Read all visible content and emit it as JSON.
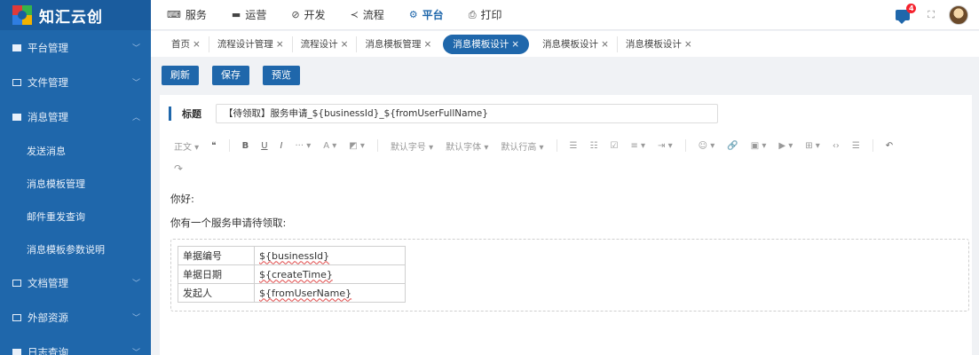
{
  "app": {
    "logo_text": "知汇云创"
  },
  "sidebar": {
    "items": [
      {
        "label": "平台管理",
        "chevron": "﹀"
      },
      {
        "label": "文件管理",
        "chevron": "﹀"
      },
      {
        "label": "消息管理",
        "chevron": "︿",
        "children": [
          "发送消息",
          "消息模板管理",
          "邮件重发查询",
          "消息模板参数说明"
        ]
      },
      {
        "label": "文档管理",
        "chevron": "﹀"
      },
      {
        "label": "外部资源",
        "chevron": "﹀"
      },
      {
        "label": "日志查询",
        "chevron": "﹀"
      }
    ]
  },
  "topnav": {
    "items": [
      {
        "label": "服务",
        "icon": "⌨"
      },
      {
        "label": "运营",
        "icon": "▬"
      },
      {
        "label": "开发",
        "icon": "⊘"
      },
      {
        "label": "流程",
        "icon": "≺"
      },
      {
        "label": "平台",
        "icon": "⚙"
      },
      {
        "label": "打印",
        "icon": "⎙"
      }
    ],
    "badge_count": "4",
    "fullscreen_glyph": "⛶"
  },
  "tabs": [
    {
      "label": "首页"
    },
    {
      "label": "流程设计管理"
    },
    {
      "label": "流程设计"
    },
    {
      "label": "消息模板管理"
    },
    {
      "label": "消息模板设计"
    },
    {
      "label": "消息模板设计"
    },
    {
      "label": "消息模板设计"
    }
  ],
  "tab_close": "×",
  "toolbar": {
    "refresh": "刷新",
    "save": "保存",
    "preview": "预览"
  },
  "form": {
    "title_label": "标题",
    "title_value": "【待领取】服务申请_${businessId}_${fromUserFullName}"
  },
  "editor_toolbar": {
    "paragraph": "正文 ▾",
    "quote": "❝",
    "bold": "B",
    "underline": "U",
    "italic": "I",
    "more": "··· ▾",
    "font_color": "A ▾",
    "bg_color": "◩ ▾",
    "font_size": "默认字号 ▾",
    "font_family": "默认字体 ▾",
    "line_height": "默认行高 ▾",
    "bulleted": "☰",
    "numbered": "☷",
    "todo": "☑",
    "align": "≡ ▾",
    "indent": "⇥ ▾",
    "emoji": "☺ ▾",
    "link": "🔗",
    "image": "▣ ▾",
    "video": "▶ ▾",
    "table": "⊞ ▾",
    "code": "‹›",
    "divider": "☰",
    "undo": "↶",
    "redo": "↷"
  },
  "content": {
    "greeting": "你好:",
    "message": "你有一个服务申请待领取:",
    "table": [
      {
        "key": "单据编号",
        "value": "${businessId}"
      },
      {
        "key": "单据日期",
        "value": "${createTime}"
      },
      {
        "key": "发起人",
        "value": "${fromUserName}"
      }
    ]
  },
  "colors": {
    "brand": "#1f67ab",
    "badge": "#f5222d"
  }
}
